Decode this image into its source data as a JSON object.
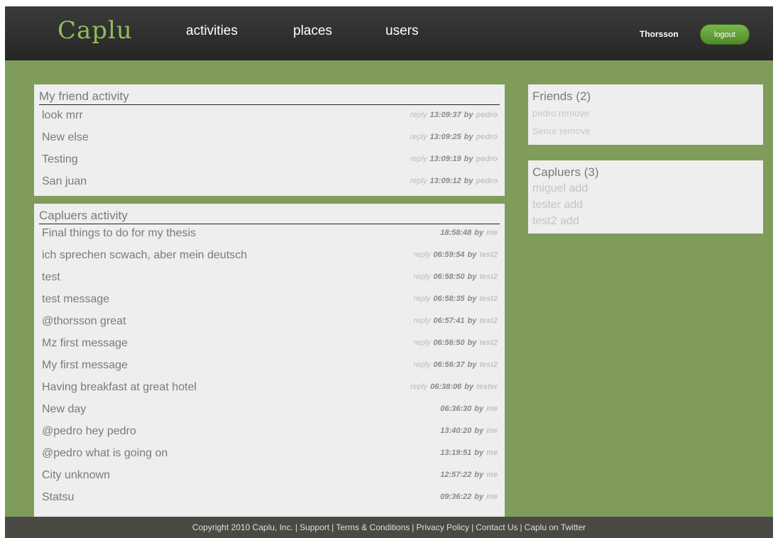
{
  "header": {
    "logo": "Caplu",
    "nav": [
      "activities",
      "places",
      "users"
    ],
    "username": "Thorsson",
    "logout_label": "logout"
  },
  "friend_activity": {
    "title": "My friend activity",
    "items": [
      {
        "text": "look mrr",
        "reply": "reply",
        "time": "13:09:37",
        "by": "by",
        "user": "pedro"
      },
      {
        "text": "New else",
        "reply": "reply",
        "time": "13:09:25",
        "by": "by",
        "user": "pedro"
      },
      {
        "text": "Testing",
        "reply": "reply",
        "time": "13:09:19",
        "by": "by",
        "user": "pedro"
      },
      {
        "text": "San juan",
        "reply": "reply",
        "time": "13:09:12",
        "by": "by",
        "user": "pedro"
      }
    ]
  },
  "capluers_activity": {
    "title": "Capluers activity",
    "items": [
      {
        "text": "Final things to do for my thesis",
        "reply": "",
        "time": "18:58:48",
        "by": "by",
        "user": "me"
      },
      {
        "text": "ich sprechen scwach, aber mein deutsch",
        "reply": "reply",
        "time": "06:59:54",
        "by": "by",
        "user": "test2"
      },
      {
        "text": "test",
        "reply": "reply",
        "time": "06:58:50",
        "by": "by",
        "user": "test2"
      },
      {
        "text": "test message",
        "reply": "reply",
        "time": "06:58:35",
        "by": "by",
        "user": "test2"
      },
      {
        "text": "@thorsson great",
        "reply": "reply",
        "time": "06:57:41",
        "by": "by",
        "user": "test2"
      },
      {
        "text": "Mz first message",
        "reply": "reply",
        "time": "06:56:50",
        "by": "by",
        "user": "test2"
      },
      {
        "text": "My first message",
        "reply": "reply",
        "time": "06:56:37",
        "by": "by",
        "user": "test2"
      },
      {
        "text": "Having breakfast at great hotel",
        "reply": "reply",
        "time": "06:38:06",
        "by": "by",
        "user": "tester"
      },
      {
        "text": "New day",
        "reply": "",
        "time": "06:36:30",
        "by": "by",
        "user": "me"
      },
      {
        "text": "@pedro hey pedro",
        "reply": "",
        "time": "13:40:20",
        "by": "by",
        "user": "me"
      },
      {
        "text": "@pedro what is going on",
        "reply": "",
        "time": "13:19:51",
        "by": "by",
        "user": "me"
      },
      {
        "text": "City unknown",
        "reply": "",
        "time": "12:57:22",
        "by": "by",
        "user": "me"
      },
      {
        "text": "Statsu",
        "reply": "",
        "time": "09:36:22",
        "by": "by",
        "user": "me"
      }
    ]
  },
  "friends": {
    "title": "Friends (2)",
    "items": [
      {
        "name": "pedro",
        "action": "remove"
      },
      {
        "name": "Senor",
        "action": "remove"
      }
    ]
  },
  "capluers": {
    "title": "Capluers (3)",
    "items": [
      {
        "name": "miguel",
        "action": "add"
      },
      {
        "name": "tester",
        "action": "add"
      },
      {
        "name": "test2",
        "action": "add"
      }
    ]
  },
  "footer": {
    "copyright": "Copyright 2010 Caplu, Inc.",
    "links": [
      "Support",
      "Terms & Conditions",
      "Privacy Policy",
      "Contact Us",
      "Caplu on Twitter"
    ],
    "separator": "|"
  },
  "colors": {
    "background": "#7f9c5b",
    "header": "#2f2f2f",
    "logo": "#8fbf55",
    "logout_button": "#5f9b35",
    "panel": "#eeeeee",
    "footer": "#4a4a44"
  }
}
